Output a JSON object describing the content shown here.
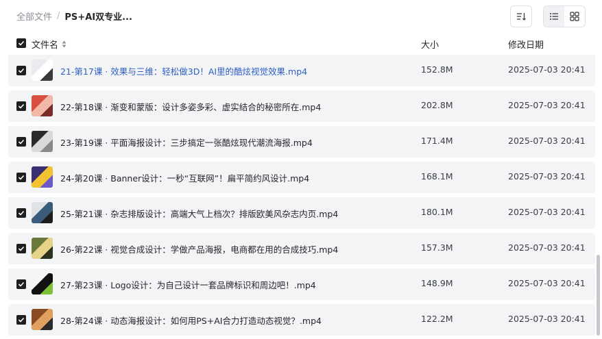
{
  "breadcrumb": {
    "root": "全部文件",
    "separator": "/",
    "current": "PS+AI双专业..."
  },
  "header": {
    "name": "文件名",
    "size": "大小",
    "date": "修改日期"
  },
  "files": [
    {
      "name": "21-第17课 · 效果与三维：轻松做3D！AI里的酷炫视觉效果.mp4",
      "size": "152.8M",
      "date": "2025-07-03 20:41",
      "thumb_colors": [
        "#e9ebee",
        "#ffffff",
        "#3a3a3a"
      ]
    },
    {
      "name": "22-第18课 · 渐变和蒙版：设计多姿多彩、虚实结合的秘密所在.mp4",
      "size": "202.8M",
      "date": "2025-07-03 20:41",
      "thumb_colors": [
        "#d64f3f",
        "#f1b7a7",
        "#7a2b2b"
      ]
    },
    {
      "name": "23-第19课 · 平面海报设计：三步搞定一张酷炫现代潮流海报.mp4",
      "size": "171.4M",
      "date": "2025-07-03 20:41",
      "thumb_colors": [
        "#2b2b2b",
        "#d9d9d9",
        "#8a8a8a"
      ]
    },
    {
      "name": "24-第20课 · Banner设计：一秒“互联网”！扁平简约风设计.mp4",
      "size": "168.1M",
      "date": "2025-07-03 20:41",
      "thumb_colors": [
        "#3a2f73",
        "#f2c230",
        "#6d58c9"
      ]
    },
    {
      "name": "25-第21课 · 杂志排版设计：高端大气上档次？排版欧美风杂志内页.mp4",
      "size": "180.1M",
      "date": "2025-07-03 20:41",
      "thumb_colors": [
        "#dfe3e8",
        "#3b5b7a",
        "#1c1c1c"
      ]
    },
    {
      "name": "26-第22课 · 视觉合成设计：学做产品海报，电商都在用的合成技巧.mp4",
      "size": "157.3M",
      "date": "2025-07-03 20:41",
      "thumb_colors": [
        "#6b7a3a",
        "#e7d28a",
        "#2b3320"
      ]
    },
    {
      "name": "27-第23课 · Logo设计：为自己设计一套品牌标识和周边吧！.mp4",
      "size": "148.9M",
      "date": "2025-07-03 20:41",
      "thumb_colors": [
        "#f4f4f4",
        "#111111",
        "#7bbf3a"
      ]
    },
    {
      "name": "28-第24课 · 动态海报设计：如何用PS+AI合力打造动态视觉？.mp4",
      "size": "122.2M",
      "date": "2025-07-03 20:41",
      "thumb_colors": [
        "#8a4b22",
        "#e0a060",
        "#2a2a2a"
      ]
    }
  ]
}
